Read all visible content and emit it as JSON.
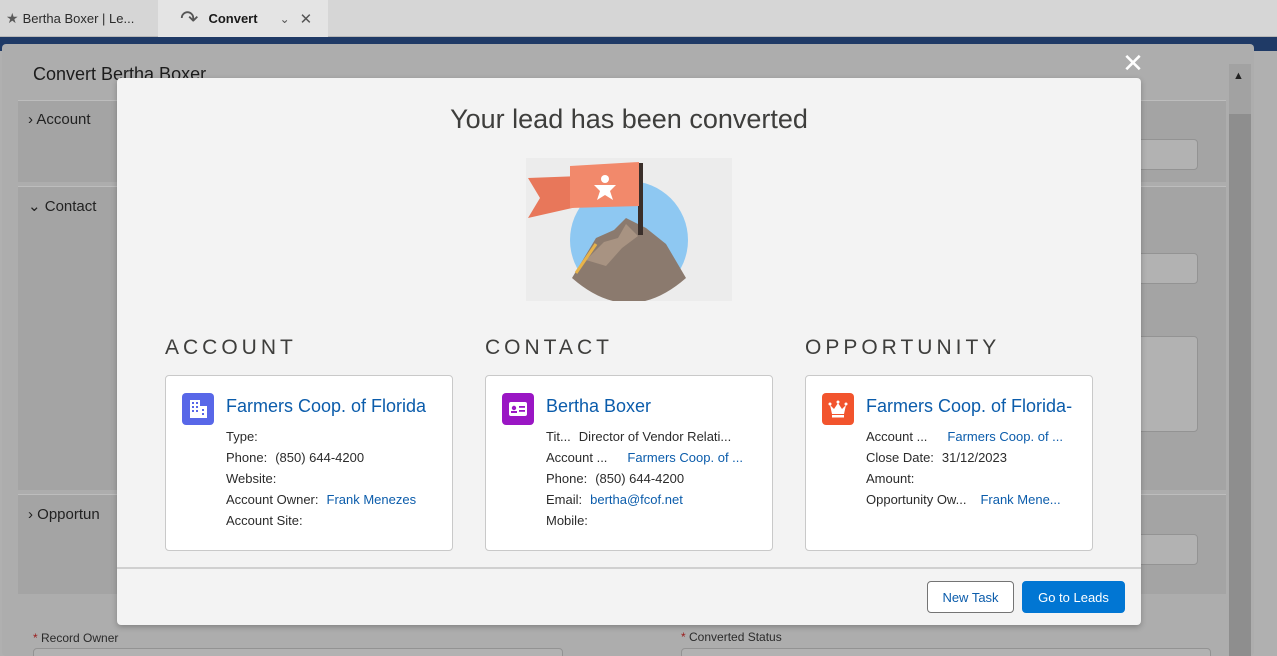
{
  "tabs": [
    {
      "label": "Bertha Boxer | Le...",
      "icon": "star-icon"
    },
    {
      "label": "Convert",
      "icon": "redo-icon"
    }
  ],
  "background": {
    "title": "Convert Bertha Boxer",
    "sections": [
      "Account",
      "Contact",
      "Opportun"
    ],
    "record_owner_label": "Record Owner",
    "converted_status_label": "Converted Status"
  },
  "modal": {
    "title": "Your lead has been converted",
    "headings": {
      "account": "ACCOUNT",
      "contact": "CONTACT",
      "opportunity": "OPPORTUNITY"
    },
    "account": {
      "title": "Farmers Coop. of Florida",
      "icon": "account-building-icon",
      "icon_color": "#5867e8",
      "rows": [
        {
          "label": "Type:",
          "value": ""
        },
        {
          "label": "Phone:",
          "value": "(850) 644-4200"
        },
        {
          "label": "Website:",
          "value": ""
        },
        {
          "label": "Account Owner:",
          "value": "Frank Menezes"
        },
        {
          "label": "Account Site:",
          "value": ""
        }
      ]
    },
    "contact": {
      "title": "Bertha Boxer",
      "icon": "contact-card-icon",
      "icon_color": "#9a16c4",
      "rows": [
        {
          "label": "Tit...",
          "value": "Director of Vendor Relati..."
        },
        {
          "label": "Account ...",
          "value": "Farmers Coop. of ..."
        },
        {
          "label": "Phone:",
          "value": "(850) 644-4200"
        },
        {
          "label": "Email:",
          "value": "bertha@fcof.net"
        },
        {
          "label": "Mobile:",
          "value": ""
        }
      ]
    },
    "opportunity": {
      "title": "Farmers Coop. of Florida-",
      "icon": "opportunity-crown-icon",
      "icon_color": "#f2542d",
      "rows": [
        {
          "label": "Account ...",
          "value": "Farmers Coop. of ..."
        },
        {
          "label": "Close Date:",
          "value": "31/12/2023"
        },
        {
          "label": "Amount:",
          "value": ""
        },
        {
          "label": "Opportunity Ow...",
          "value": "Frank Mene..."
        }
      ]
    },
    "buttons": {
      "new_task": "New Task",
      "go_to_leads": "Go to Leads"
    }
  }
}
